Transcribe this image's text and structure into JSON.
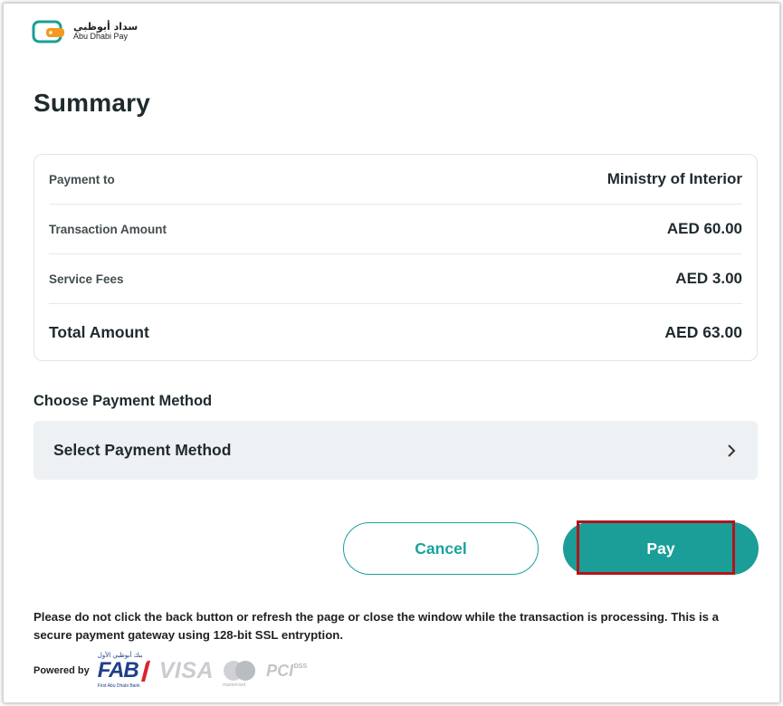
{
  "brand": {
    "name_ar": "سداد أبوظبي",
    "name_en": "Abu Dhabi Pay",
    "colors": {
      "teal": "#1a9e97",
      "orange": "#f39a1c"
    }
  },
  "page": {
    "title": "Summary"
  },
  "summary": {
    "rows": [
      {
        "label": "Payment to",
        "value": "Ministry of Interior"
      },
      {
        "label": "Transaction Amount",
        "value": "AED 60.00"
      },
      {
        "label": "Service Fees",
        "value": "AED 3.00"
      }
    ],
    "total": {
      "label": "Total Amount",
      "value": "AED 63.00"
    }
  },
  "payment_method": {
    "heading": "Choose Payment Method",
    "select_label": "Select Payment Method",
    "icon": "chevron-right-icon"
  },
  "actions": {
    "cancel_label": "Cancel",
    "pay_label": "Pay",
    "highlight_color": "#b3141c"
  },
  "notice": "Please do not click the back button or refresh the page or close the window while the transaction is processing. This is a secure payment gateway using 128-bit SSL entryption.",
  "footer": {
    "powered_by": "Powered by",
    "fab_ar": "بنك أبوظبي الأول",
    "fab": "FAB",
    "fab_sub": "First Abu Dhabi Bank",
    "visa": "VISA",
    "mastercard_sub": "mastercard",
    "pci": "PCI",
    "pci_dss": "DSS"
  }
}
